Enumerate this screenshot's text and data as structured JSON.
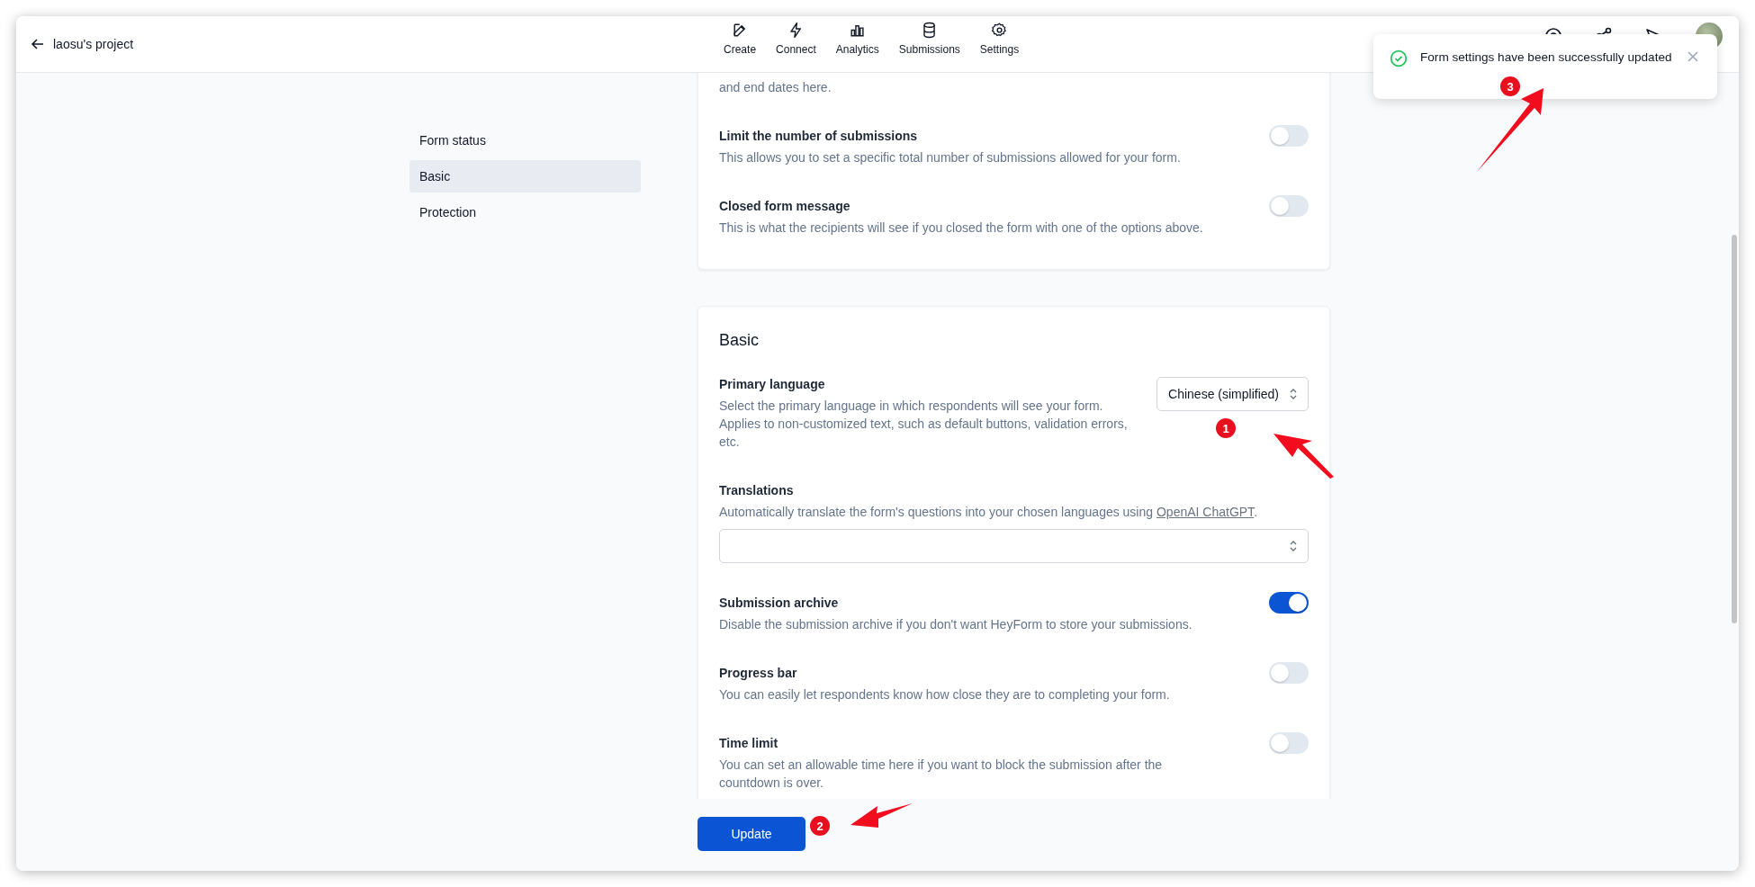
{
  "header": {
    "back_label": "laosu's project",
    "nav": [
      {
        "label": "Create"
      },
      {
        "label": "Connect"
      },
      {
        "label": "Analytics"
      },
      {
        "label": "Submissions"
      },
      {
        "label": "Settings"
      }
    ]
  },
  "sidebar": {
    "items": [
      {
        "label": "Form status",
        "selected": false
      },
      {
        "label": "Basic",
        "selected": true
      },
      {
        "label": "Protection",
        "selected": false
      }
    ]
  },
  "sections": [
    {
      "cut_text": "and end dates here.",
      "settings": [
        {
          "kind": "toggle",
          "title": "Limit the number of submissions",
          "description": "This allows you to set a specific total number of submissions allowed for your form.",
          "on": false
        },
        {
          "kind": "toggle",
          "title": "Closed form message",
          "description": "This is what the recipients will see if you closed the form with one of the options above.",
          "on": false
        }
      ]
    },
    {
      "title": "Basic",
      "settings": [
        {
          "kind": "select",
          "title": "Primary language",
          "description": "Select the primary language in which respondents will see your form. Applies to non-customized text, such as default buttons, validation errors, etc.",
          "value": "Chinese (simplified)"
        },
        {
          "kind": "multiselect",
          "title": "Translations",
          "description": "Automatically translate the form's questions into your chosen languages using ",
          "link": "OpenAI ChatGPT",
          "description_end": "."
        },
        {
          "kind": "toggle",
          "title": "Submission archive",
          "description": "Disable the submission archive if you don't want HeyForm to store your submissions.",
          "on": true
        },
        {
          "kind": "toggle",
          "title": "Progress bar",
          "description": "You can easily let respondents know how close they are to completing your form.",
          "on": false
        },
        {
          "kind": "toggle",
          "title": "Time limit",
          "description": "You can set an allowable time here if you want to block the submission after the countdown is over.",
          "on": false
        }
      ]
    }
  ],
  "footer": {
    "button": "Update"
  },
  "toast": {
    "message": "Form settings have been successfully updated"
  },
  "annotations": [
    {
      "number": "1"
    },
    {
      "number": "2"
    },
    {
      "number": "3"
    }
  ]
}
